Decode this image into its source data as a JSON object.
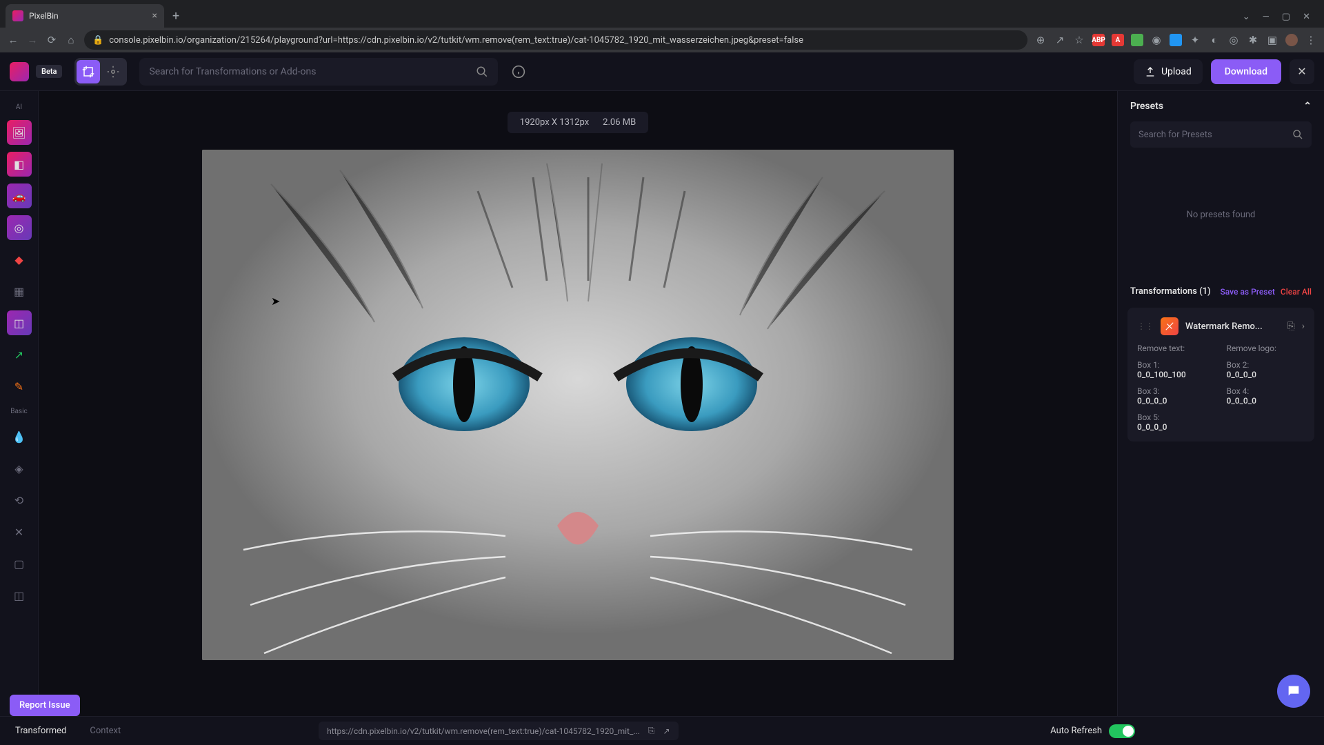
{
  "browser": {
    "tab_title": "PixelBin",
    "url": "console.pixelbin.io/organization/215264/playground?url=https://cdn.pixelbin.io/v2/tutkit/wm.remove(rem_text:true)/cat-1045782_1920_mit_wasserzeichen.jpeg&preset=false"
  },
  "header": {
    "beta": "Beta",
    "search_placeholder": "Search for Transformations or Add-ons",
    "upload": "Upload",
    "download": "Download"
  },
  "sidebar": {
    "ai_label": "AI",
    "basic_label": "Basic"
  },
  "canvas": {
    "dimensions": "1920px X 1312px",
    "filesize": "2.06 MB"
  },
  "right": {
    "presets_title": "Presets",
    "preset_search_placeholder": "Search for Presets",
    "no_presets": "No presets found",
    "transformations_title": "Transformations (1)",
    "save_preset": "Save as Preset",
    "clear_all": "Clear All",
    "card": {
      "name": "Watermark Remo...",
      "params": {
        "remove_text_label": "Remove text:",
        "remove_logo_label": "Remove logo:",
        "box1_label": "Box 1:",
        "box1_val": "0_0_100_100",
        "box2_label": "Box 2:",
        "box2_val": "0_0_0_0",
        "box3_label": "Box 3:",
        "box3_val": "0_0_0_0",
        "box4_label": "Box 4:",
        "box4_val": "0_0_0_0",
        "box5_label": "Box 5:",
        "box5_val": "0_0_0_0"
      }
    }
  },
  "bottom": {
    "transformed": "Transformed",
    "context": "Context",
    "url": "https://cdn.pixelbin.io/v2/tutkit/wm.remove(rem_text:true)/cat-1045782_1920_mit_...",
    "auto_refresh": "Auto Refresh"
  },
  "report_issue": "Report Issue"
}
